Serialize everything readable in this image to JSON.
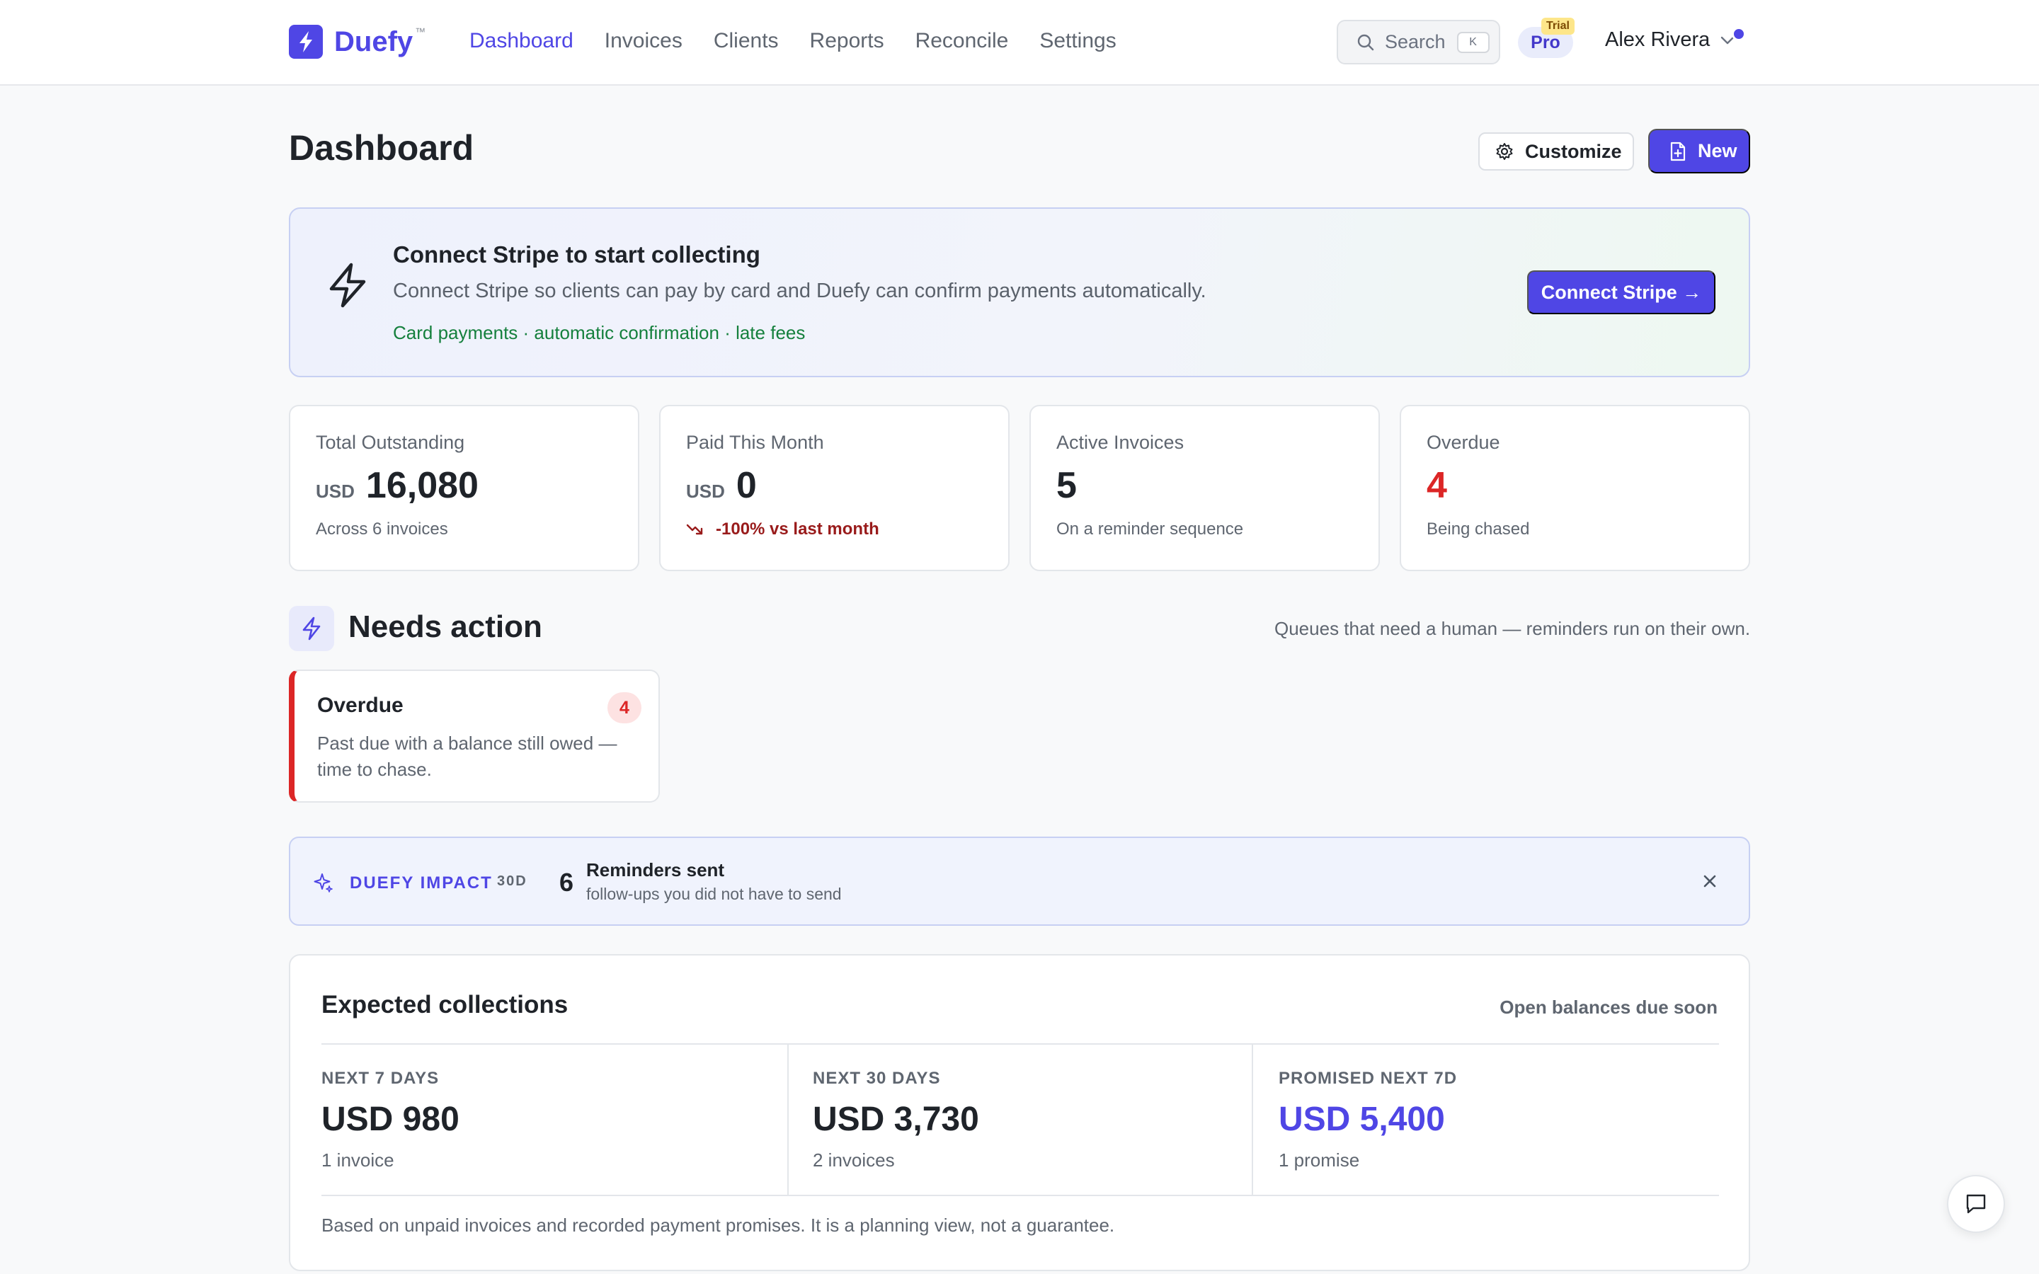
{
  "brand": {
    "name": "Duefy",
    "tm": "™",
    "color": "#4f46e5"
  },
  "nav": {
    "items": [
      {
        "label": "Dashboard",
        "active": true
      },
      {
        "label": "Invoices",
        "active": false
      },
      {
        "label": "Clients",
        "active": false
      },
      {
        "label": "Reports",
        "active": false
      },
      {
        "label": "Reconcile",
        "active": false
      },
      {
        "label": "Settings",
        "active": false
      }
    ]
  },
  "search": {
    "label": "Search",
    "shortcut": "K"
  },
  "plan": {
    "name": "Pro",
    "tag": "Trial"
  },
  "user": {
    "name": "Alex Rivera"
  },
  "header": {
    "title": "Dashboard",
    "customize_label": "Customize",
    "new_label": "New"
  },
  "banner": {
    "title": "Connect Stripe to start collecting",
    "subtitle": "Connect Stripe so clients can pay by card and Duefy can confirm payments automatically.",
    "features": "Card payments · automatic confirmation · late fees",
    "cta": "Connect Stripe →"
  },
  "kpis": [
    {
      "label": "Total Outstanding",
      "currency": "USD",
      "value": "16,080",
      "note": "Across 6 invoices"
    },
    {
      "label": "Paid This Month",
      "currency": "USD",
      "value": "0",
      "note": "-100% vs last month"
    },
    {
      "label": "Active Invoices",
      "value": "5",
      "note": "On a reminder sequence"
    },
    {
      "label": "Overdue",
      "value": "4",
      "note": "Being chased"
    }
  ],
  "needs_action": {
    "title": "Needs action",
    "subtitle": "Queues that need a human — reminders run on their own.",
    "queues": [
      {
        "title": "Overdue",
        "count": "4",
        "description": "Past due with a balance still owed — time to chase."
      }
    ]
  },
  "impact": {
    "label": "DUEFY IMPACT",
    "period": "30D",
    "value": "6",
    "title": "Reminders sent",
    "description": "follow-ups you did not have to send"
  },
  "collections": {
    "title": "Expected collections",
    "subtitle": "Open balances due soon",
    "cells": [
      {
        "label": "NEXT 7 DAYS",
        "value": "USD 980",
        "note": "1 invoice"
      },
      {
        "label": "NEXT 30 DAYS",
        "value": "USD 3,730",
        "note": "2 invoices"
      },
      {
        "label": "PROMISED NEXT 7D",
        "value": "USD 5,400",
        "note": "1 promise"
      }
    ],
    "footnote": "Based on unpaid invoices and recorded payment promises. It is a planning view, not a guarantee."
  },
  "colors": {
    "accent": "#4f46e5",
    "danger": "#dc2626",
    "success": "#15803d",
    "trial": "#fde68a"
  },
  "icons": [
    "lightning-icon",
    "search-icon",
    "chevron-down-icon",
    "gear-icon",
    "file-plus-icon",
    "trend-down-icon",
    "sparkle-icon",
    "close-icon",
    "chat-icon"
  ]
}
